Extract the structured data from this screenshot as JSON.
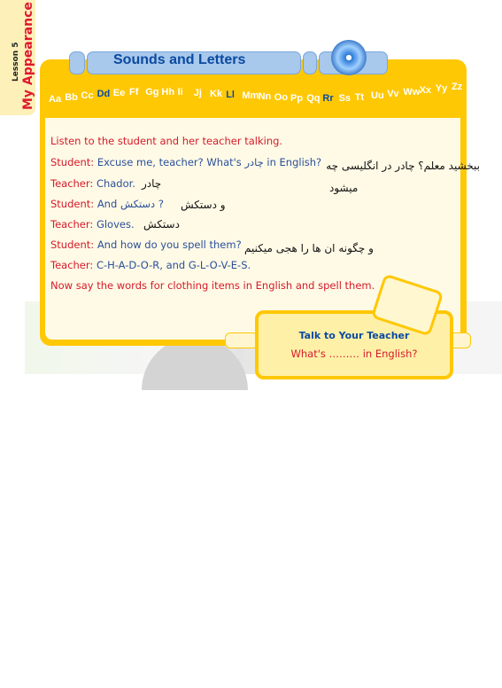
{
  "sidebar": {
    "lesson": "Lesson 5",
    "title": "My Appearance"
  },
  "header": {
    "title": "Sounds and Letters",
    "icon": "cd-icon"
  },
  "alphabet": [
    "Aa",
    "Bb",
    "Cc",
    "Dd",
    "Ee",
    "Ff",
    "Gg",
    "Hh",
    "Ii",
    "Jj",
    "Kk",
    "Ll",
    "Mm",
    "Nn",
    "Oo",
    "Pp",
    "Qq",
    "Rr",
    "Ss",
    "Tt",
    "Uu",
    "Vv",
    "Ww",
    "Xx",
    "Yy",
    "Zz"
  ],
  "alphabet_highlighted": [
    "Dd",
    "Ll",
    "Rr"
  ],
  "dialog": {
    "instruction": "Listen to the student and her teacher talking.",
    "lines": [
      {
        "speaker": "Student:",
        "text": "Excuse me, teacher? What's چادر in English?",
        "note": "ببخشید معلم؟ چادر در انگلیسی چه"
      },
      {
        "speaker": "Teacher:",
        "text": "Chador.",
        "note": "چادر"
      },
      {
        "speaker": "Student:",
        "text": "And دستکش ?",
        "note": "و دستکش"
      },
      {
        "speaker": "Teacher:",
        "text": "Gloves.",
        "note": "دستکش"
      },
      {
        "speaker": "Student:",
        "text": "And how do you spell them?",
        "note": "و چگونه ان ها را هجی میکنیم"
      },
      {
        "speaker": "Teacher:",
        "text": "C-H-A-D-O-R, and G-L-O-V-E-S.",
        "note": ""
      }
    ],
    "note_extra": "میشود",
    "closing": "Now say the words for clothing items in English and spell them."
  },
  "talk_box": {
    "title": "Talk to Your Teacher",
    "prompt": "What's ……… in English?"
  },
  "colors": {
    "frame": "#ffc805",
    "header": "#a8c8ec",
    "red": "#d51a2a",
    "blue": "#2a4f9a",
    "title_blue": "#0a4aa0"
  }
}
